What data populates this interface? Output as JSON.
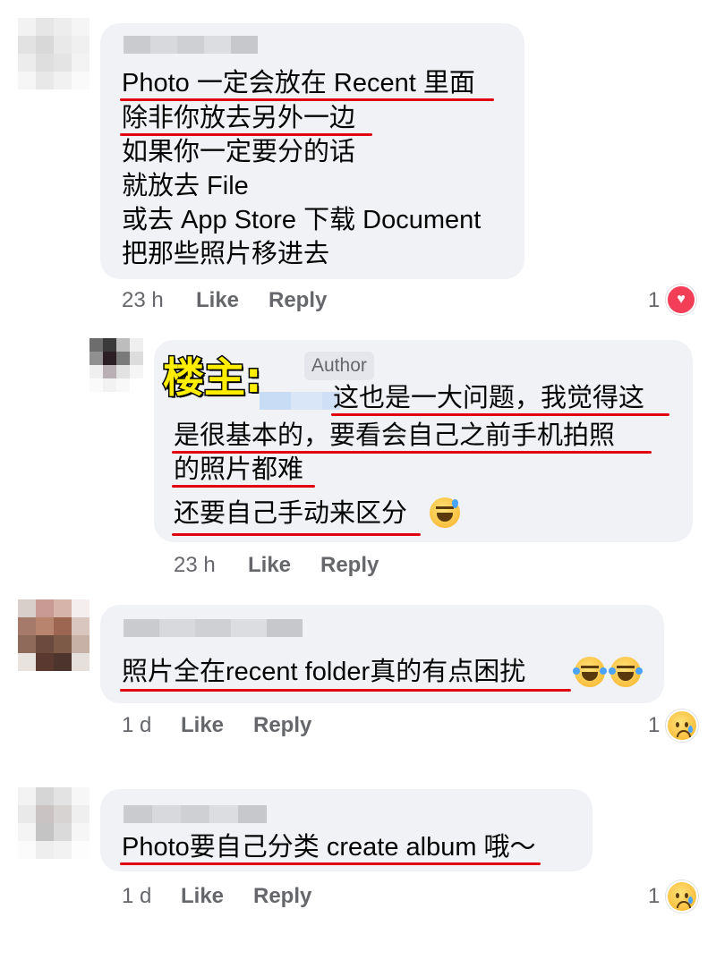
{
  "comments": [
    {
      "lines": [
        "Photo 一定会放在 Recent 里面",
        "除非你放去另外一边",
        "如果你一定要分的话",
        "就放去 File",
        "或去 App Store 下载 Document",
        "把那些照片移进去"
      ],
      "time": "23 h",
      "like": "Like",
      "reply": "Reply",
      "reaction_count": "1",
      "reaction_icon": "heart-icon"
    },
    {
      "overlay_label": "楼主:",
      "badge": "Author",
      "lines": [
        "这也是一大问题，我觉得这",
        "是很基本的，要看会自己之前手机拍照",
        "的照片都难",
        "还要自己手动来区分"
      ],
      "time": "23 h",
      "like": "Like",
      "reply": "Reply",
      "trailing_emoji": "grinning-sweat-emoji"
    },
    {
      "lines": [
        "照片全在recent folder真的有点困扰"
      ],
      "time": "1 d",
      "like": "Like",
      "reply": "Reply",
      "reaction_count": "1",
      "reaction_icon": "sad-icon",
      "trailing_emoji": "tears-of-joy-emoji"
    },
    {
      "lines": [
        "Photo要自己分类 create album 哦～"
      ],
      "time": "1 d",
      "like": "Like",
      "reply": "Reply",
      "reaction_count": "1",
      "reaction_icon": "sad-icon"
    }
  ],
  "colors": {
    "bubble": "#f0f2f5",
    "meta": "#65676b",
    "underline": "#e00010",
    "heart": "#f33e58"
  }
}
